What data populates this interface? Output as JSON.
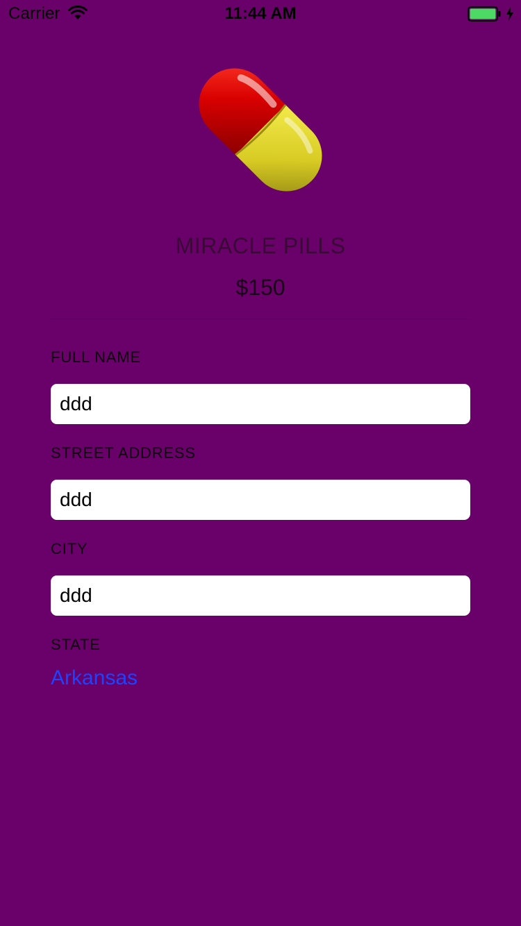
{
  "status_bar": {
    "carrier": "Carrier",
    "time": "11:44 AM",
    "battery_color": "#4cd964"
  },
  "product": {
    "name": "MIRACLE PILLS",
    "price": "$150",
    "icon": "pill-icon"
  },
  "form": {
    "full_name": {
      "label": "FULL NAME",
      "value": "ddd"
    },
    "street_address": {
      "label": "STREET ADDRESS",
      "value": "ddd"
    },
    "city": {
      "label": "CITY",
      "value": "ddd"
    },
    "state": {
      "label": "STATE",
      "value": "Arkansas"
    }
  },
  "colors": {
    "background": "#6a0069",
    "link": "#1a44ff",
    "pill_red": "#d80000",
    "pill_yellow": "#dccf2a"
  }
}
